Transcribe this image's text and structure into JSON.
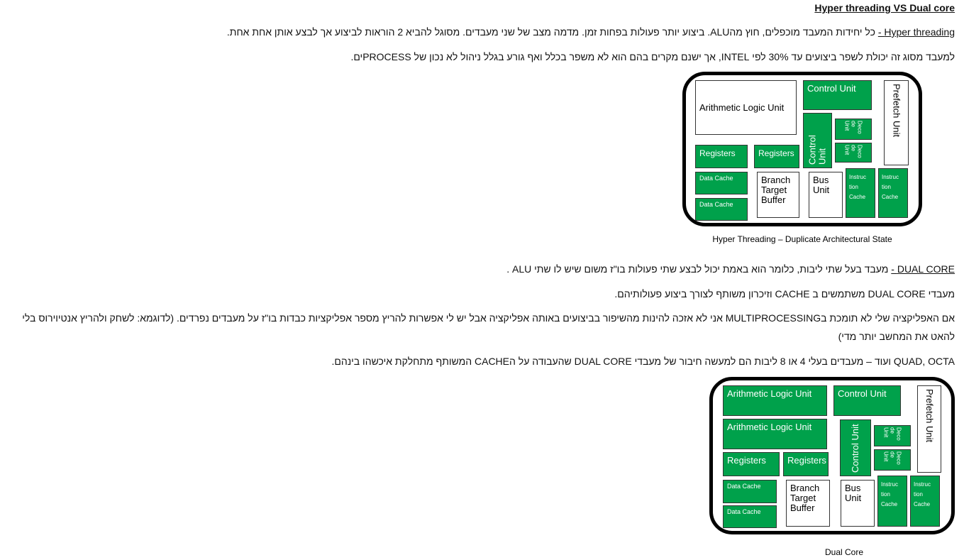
{
  "header": {
    "title": "Hyper threading VS Dual core"
  },
  "hyper": {
    "term": "Hyper threading -",
    "line1_rest": " כל יחידות המעבד מוכפלים, חוץ מהALU. ביצוע יותר פעולות בפחות זמן. מדמה מצב של שני מעבדים. מסוגל להביא 2 הוראות לביצוע אך לבצע אותן אחת אחת.",
    "line2": "למעבד מסוג זה יכולת לשפר ביצועים עד 30% לפי INTEL, אך ישנם מקרים בהם הוא לא משפר בכלל ואף גורע בגלל ניהול לא נכון של PROCESSים."
  },
  "dual": {
    "term": "DUAL CORE -",
    "line1_rest": " מעבד בעל שתי ליבות, כלומר הוא באמת יכול לבצע שתי פעולות בו\"ז משום שיש לו שתי ALU .",
    "line2": "מעבדי DUAL CORE  משתמשים ב CACHE  וזיכרון משותף לצורך ביצוע פעולותיהם.",
    "line3": "אם האפליקציה שלי לא תומכת בMULTIPROCESSING  אני לא אזכה להינות מהשיפור בביצועים באותה אפליקציה אבל יש לי אפשרות להריץ מספר אפליקציות כבדות בו\"ז על מעבדים נפרדים. (לדוגמא: לשחק ולהריץ אנטיוירוס בלי להאט את המחשב יותר מדי)",
    "line4": "QUAD, OCTA ועוד – מעבדים בעלי 4 או 8 ליבות הם למעשה חיבור של מעבדי DUAL CORE  שהעבודה על הCACHE המשותף מתחלקת איכשהו בינהם."
  },
  "diagram1": {
    "caption": "Hyper Threading – Duplicate Architectural State",
    "alu": "Arithmetic Logic Unit",
    "control_top": "Control Unit",
    "prefetch": "Prefetch Unit",
    "control_vert": "Control Unit",
    "decode1": "Deco de Unit",
    "decode2": "Deco de Unit",
    "registers1": "Registers",
    "registers2": "Registers",
    "data_cache1": "Data Cache",
    "data_cache2": "Data Cache",
    "btb": "Branch Target Buffer",
    "bus": "Bus Unit",
    "icache1": "Instruc tion Cache",
    "icache2": "Instruc tion Cache"
  },
  "diagram2": {
    "caption": "Dual Core",
    "alu1": "Arithmetic Logic Unit",
    "alu2": "Arithmetic Logic Unit",
    "control_top": "Control Unit",
    "prefetch": "Prefetch Unit",
    "control_vert": "Control Unit",
    "decode1": "Deco de Unit",
    "decode2": "Deco de Unit",
    "registers1": "Registers",
    "registers2": "Registers",
    "data_cache1": "Data Cache",
    "data_cache2": "Data Cache",
    "btb": "Branch Target Buffer",
    "bus": "Bus Unit",
    "icache1": "Instruc tion Cache",
    "icache2": "Instruc tion Cache"
  }
}
